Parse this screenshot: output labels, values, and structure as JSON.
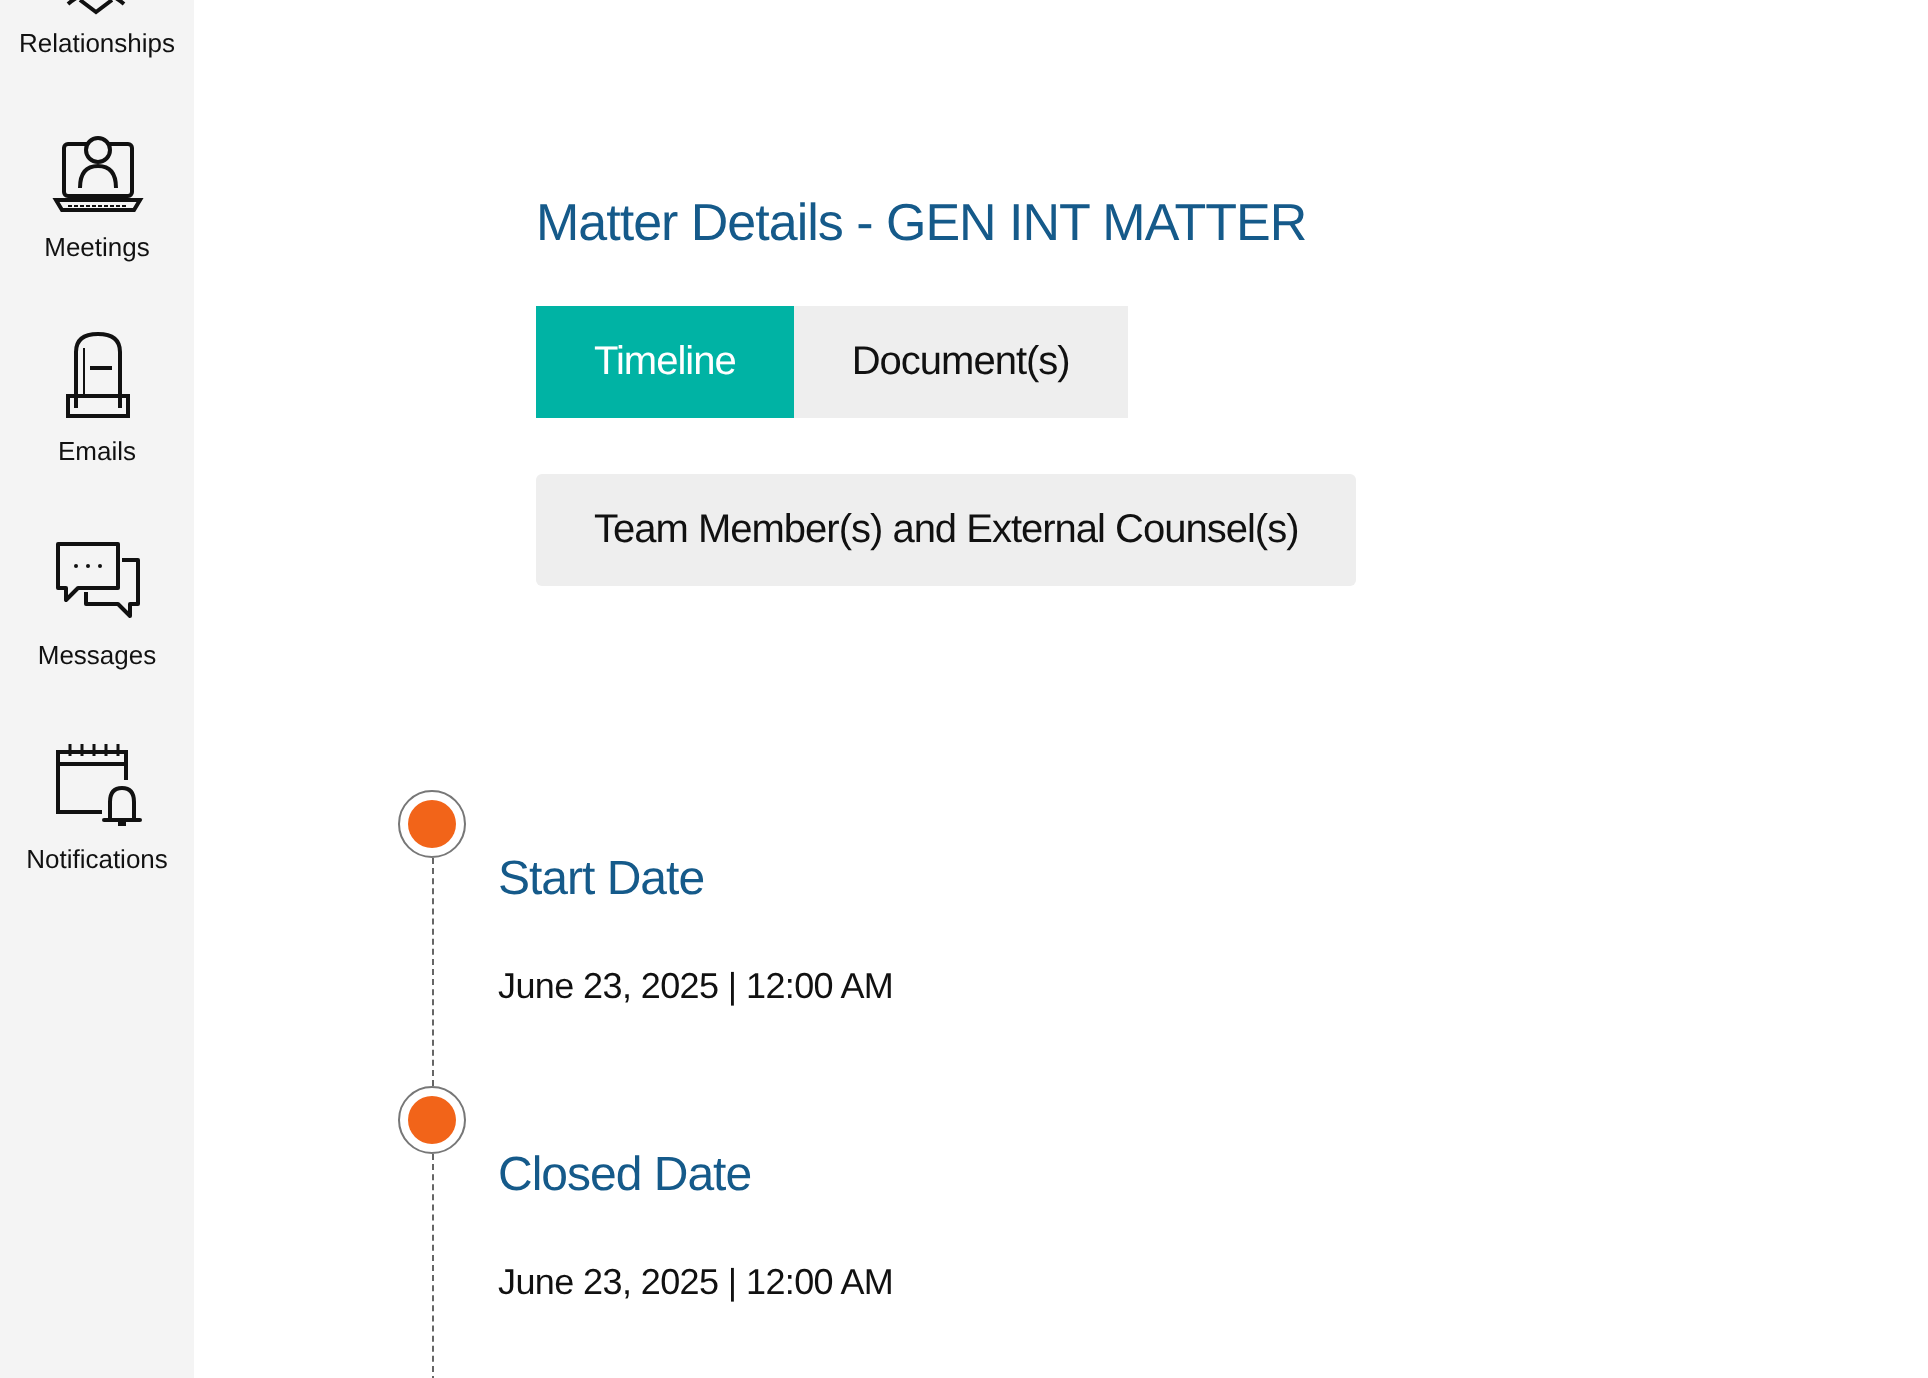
{
  "sidebar": {
    "items": [
      {
        "kind": "relationships",
        "label": "Relationships"
      },
      {
        "kind": "meetings",
        "label": "Meetings"
      },
      {
        "kind": "emails",
        "label": "Emails"
      },
      {
        "kind": "messages",
        "label": "Messages"
      },
      {
        "kind": "notifications",
        "label": "Notifications"
      }
    ]
  },
  "title": "Matter Details - GEN INT MATTER",
  "tabs": [
    {
      "label": "Timeline",
      "selected": true
    },
    {
      "label": "Document(s)",
      "selected": false
    },
    {
      "label": "Team Member(s) and External Counsel(s)",
      "selected": false
    }
  ],
  "timeline": [
    {
      "title": "Start Date",
      "date": "June 23, 2025 | 12:00 AM"
    },
    {
      "title": "Closed Date",
      "date": "June 23, 2025 | 12:00 AM"
    }
  ]
}
